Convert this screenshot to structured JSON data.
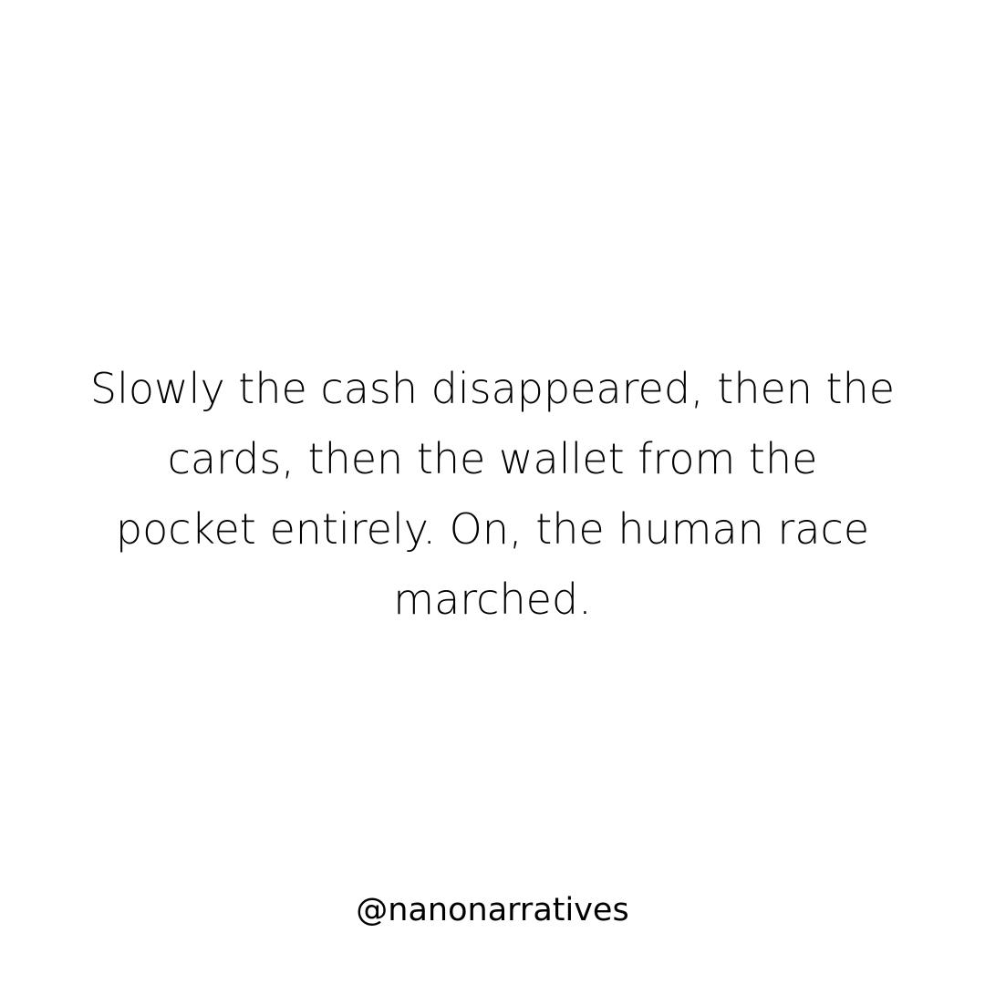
{
  "story": {
    "lines": [
      "Slowly the cash disappeared, then the",
      "cards, then the wallet from the",
      "pocket entirely. On, the human race",
      "marched."
    ]
  },
  "handle": "@nanonarratives",
  "colors": {
    "background": "#ffffff",
    "text": "#000000"
  }
}
